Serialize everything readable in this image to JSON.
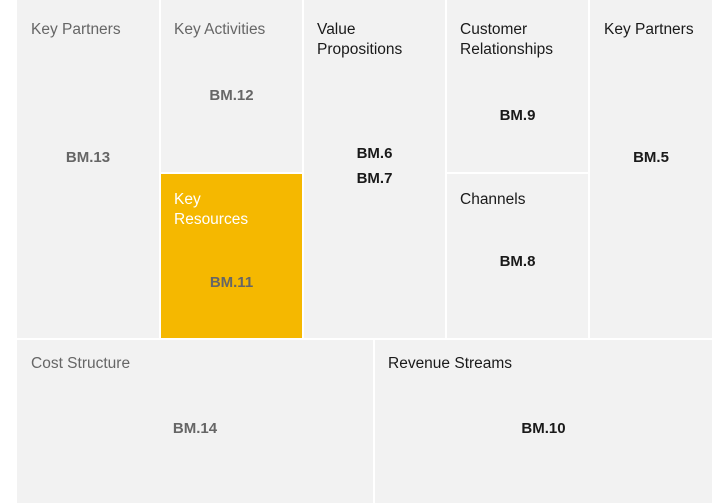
{
  "canvas": {
    "key_partners_left": {
      "title": "Key Partners",
      "code": "BM.13"
    },
    "key_activities": {
      "title": "Key Activities",
      "code": "BM.12"
    },
    "key_resources": {
      "title": "Key Resources",
      "code": "BM.11",
      "highlight_color": "#F5B800"
    },
    "value_propositions": {
      "title": "Value Propositions",
      "codes": [
        "BM.6",
        "BM.7"
      ]
    },
    "customer_relationships": {
      "title": "Customer Relationships",
      "code": "BM.9"
    },
    "channels": {
      "title": "Channels",
      "code": "BM.8"
    },
    "key_partners_right": {
      "title": "Key Partners",
      "code": "BM.5"
    },
    "cost_structure": {
      "title": "Cost Structure",
      "code": "BM.14"
    },
    "revenue_streams": {
      "title": "Revenue Streams",
      "code": "BM.10"
    }
  }
}
